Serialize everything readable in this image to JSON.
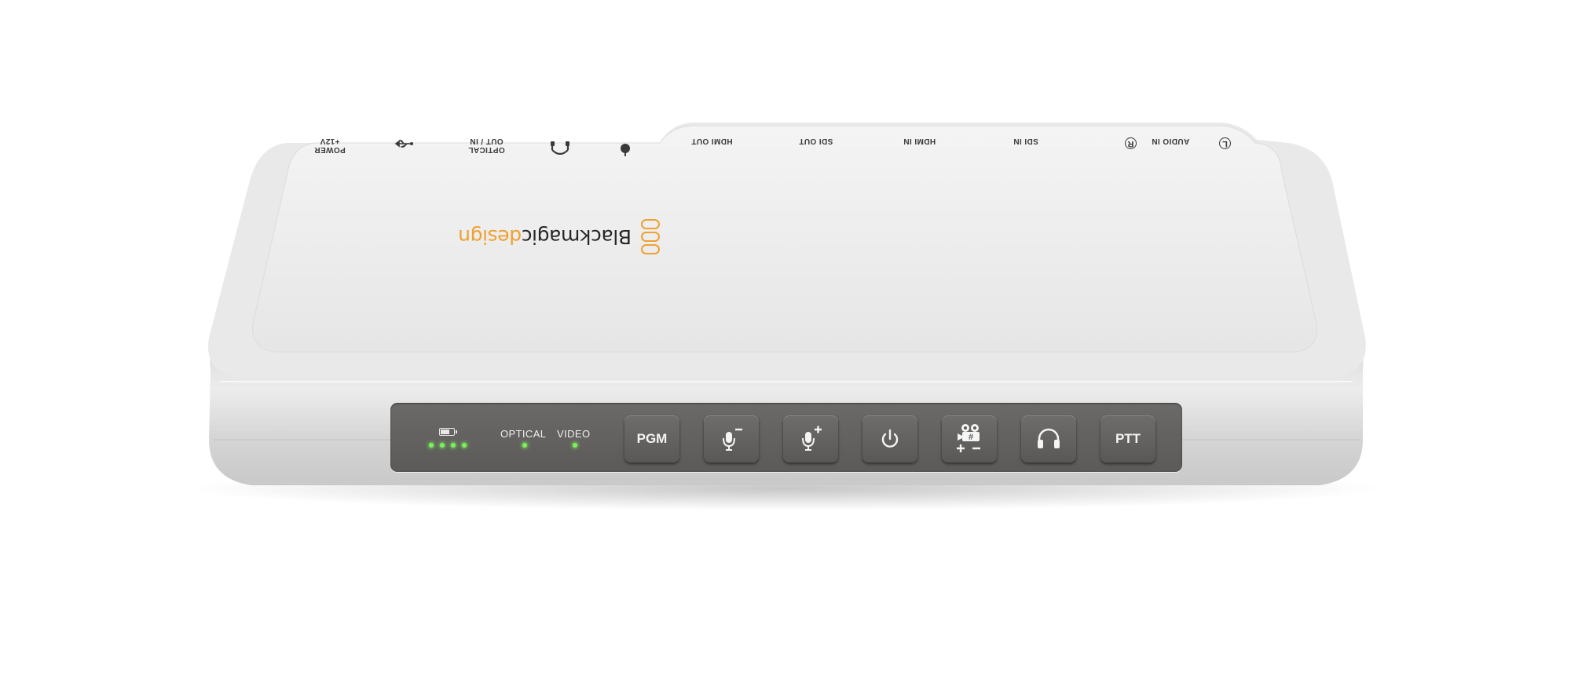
{
  "product": {
    "logo_text_primary": "Blackmagic",
    "logo_text_accent": "design",
    "logo_accent_color": "#f0a030"
  },
  "rear_ports": [
    {
      "label": "POWER\n+12V"
    },
    {
      "label": "",
      "icon": "usb-icon"
    },
    {
      "label": "OPTICAL\nOUT / IN"
    },
    {
      "label": "",
      "icon": "headset-connector-icon"
    },
    {
      "label": "",
      "icon": "ground-icon"
    },
    {
      "label": "HDMI OUT"
    },
    {
      "label": "SDI OUT"
    },
    {
      "label": "HDMI IN"
    },
    {
      "label": "SDI IN"
    },
    {
      "label": "AUDIO IN",
      "icon_right": "R",
      "icon_left": "L"
    }
  ],
  "front_panel": {
    "battery": {
      "icon": "battery-icon",
      "level": 0.75,
      "led_count": 4
    },
    "indicators": [
      {
        "label": "OPTICAL",
        "status": "on",
        "color": "#7cf05a"
      },
      {
        "label": "VIDEO",
        "status": "on",
        "color": "#7cf05a"
      }
    ],
    "buttons": [
      {
        "label": "PGM"
      },
      {
        "label": "",
        "icon": "mic-minus-icon"
      },
      {
        "label": "",
        "icon": "mic-plus-icon"
      },
      {
        "label": "",
        "icon": "power-icon"
      },
      {
        "label": "",
        "icon": "camera-number-icon"
      },
      {
        "label": "",
        "icon": "headphones-icon"
      },
      {
        "label": "PTT"
      }
    ]
  }
}
